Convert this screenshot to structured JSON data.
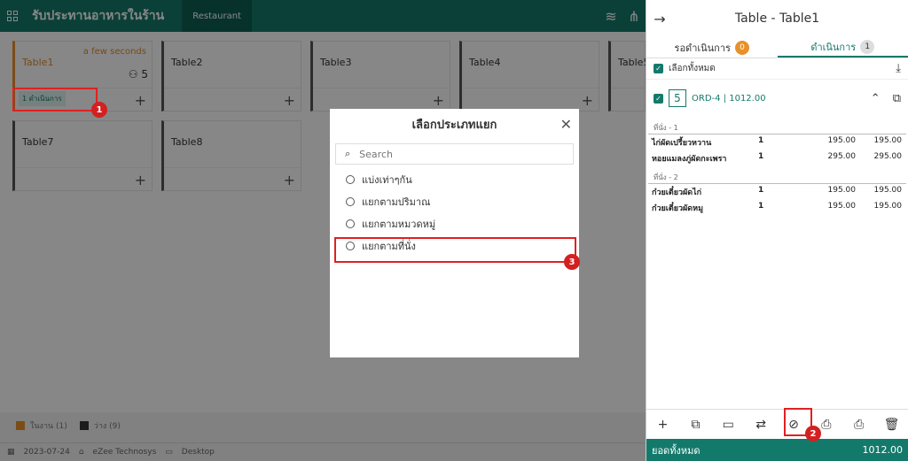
{
  "topbar": {
    "title": "รับประทานอาหารในร้าน",
    "tab": "Restaurant"
  },
  "tables": [
    {
      "name": "Table1",
      "time": "a few seconds",
      "pax": "5",
      "status": "1 ดำเนินการ"
    },
    {
      "name": "Table2"
    },
    {
      "name": "Table3"
    },
    {
      "name": "Table4"
    },
    {
      "name": "Table5"
    },
    {
      "name": "Table7"
    },
    {
      "name": "Table8"
    }
  ],
  "legend": {
    "busy": "ในงาน (1)",
    "free": "ว่าง (9)"
  },
  "footer": {
    "date": "2023-07-24",
    "company": "eZee Technosys",
    "device": "Desktop"
  },
  "panel": {
    "title": "Table - Table1",
    "tab_pending": "รอดำเนินการ",
    "tab_pending_count": "0",
    "tab_processing": "ดำเนินการ",
    "tab_processing_count": "1",
    "select_all": "เลือกทั้งหมด",
    "order_num": "5",
    "order_label": "ORD-4 | 1012.00",
    "seat1": "ที่นั่ง - 1",
    "seat2": "ที่นั่ง - 2",
    "items": [
      {
        "name": "ไก่ผัดเปรี้ยวหวาน",
        "qty": "1",
        "price": "195.00",
        "total": "195.00"
      },
      {
        "name": "หอยแมลงภู่ผัดกะเพรา",
        "qty": "1",
        "price": "295.00",
        "total": "295.00"
      },
      {
        "name": "ก๋วยเตี๋ยวผัดไก่",
        "qty": "1",
        "price": "195.00",
        "total": "195.00"
      },
      {
        "name": "ก๋วยเตี๋ยวผัดหมู",
        "qty": "1",
        "price": "195.00",
        "total": "195.00"
      }
    ],
    "total_label": "ยอดทั้งหมด",
    "total_value": "1012.00"
  },
  "modal": {
    "title": "เลือกประเภทแยก",
    "search_placeholder": "Search",
    "options": [
      "แบ่งเท่าๆกัน",
      "แยกตามปริมาณ",
      "แยกตามหมวดหมู่",
      "แยกตามที่นั่ง"
    ]
  },
  "annotations": [
    "1",
    "2",
    "3"
  ],
  "colors": {
    "accent": "#137a6b",
    "busy": "#e8912a",
    "highlight": "#e02020"
  }
}
